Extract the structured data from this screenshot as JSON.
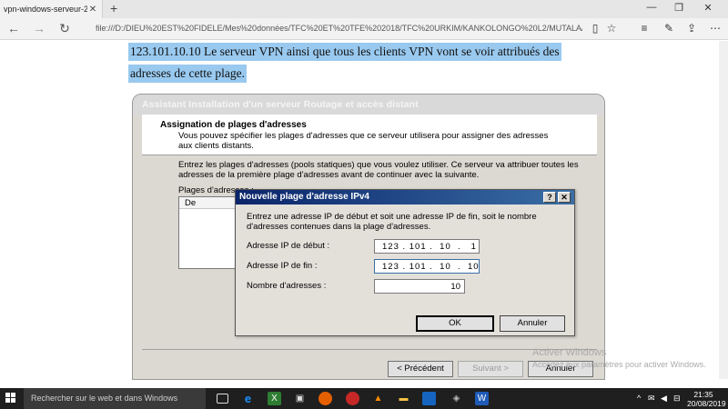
{
  "browser": {
    "tab_title": "vpn-windows-serveur-2(",
    "tab_close": "✕",
    "new_tab": "+",
    "url": "file:///D:/DIEU%20EST%20FIDELE/Mes%20données/TFC%20ET%20TFE%202018/TFC%20URKIM/KANKOLONGO%20L2/MUTALA/vpn-windo",
    "back": "←",
    "forward": "→",
    "refresh": "↻",
    "minimize": "—",
    "maximize": "❐",
    "close": "✕"
  },
  "document": {
    "line1": "123.101.10.10 Le serveur VPN ainsi que tous les clients VPN vont se voir attribués des",
    "line2": "adresses de cette plage.",
    "highlight_color": "#99c9ef"
  },
  "wizard": {
    "title": "Assistant Installation d'un serveur Routage et accès distant",
    "heading": "Assignation de plages d'adresses",
    "subheading": "Vous pouvez spécifier les plages d'adresses que ce serveur utilisera pour assigner des adresses aux clients distants.",
    "intro": "Entrez les plages d'adresses (pools statiques) que vous voulez utiliser. Ce serveur va attribuer toutes les adresses de la première plage d'adresses avant de continuer avec la suivante.",
    "list_label": "Plages d'adresses :",
    "list_column": "De",
    "btn_back": "< Précédent",
    "btn_next": "Suivant >",
    "btn_cancel": "Annuler"
  },
  "modal": {
    "title": "Nouvelle plage d'adresse IPv4",
    "help": "?",
    "close": "✕",
    "description": "Entrez une adresse IP de début et soit une adresse IP de fin, soit le nombre d'adresses contenues dans la plage d'adresses.",
    "start_label": "Adresse IP de début :",
    "start_value": "123 . 101 .  10  .   1",
    "end_label": "Adresse IP de fin :",
    "end_value": "123 . 101 .  10  .  10",
    "count_label": "Nombre d'adresses :",
    "count_value": "10",
    "ok": "OK",
    "cancel": "Annuler"
  },
  "watermark": {
    "line1": "Activer Windows",
    "line2": "Accédez aux paramètres pour activer Windows."
  },
  "taskbar": {
    "search_placeholder": "Rechercher sur le web et dans Windows",
    "time": "21:35",
    "date": "20/08/2019"
  }
}
